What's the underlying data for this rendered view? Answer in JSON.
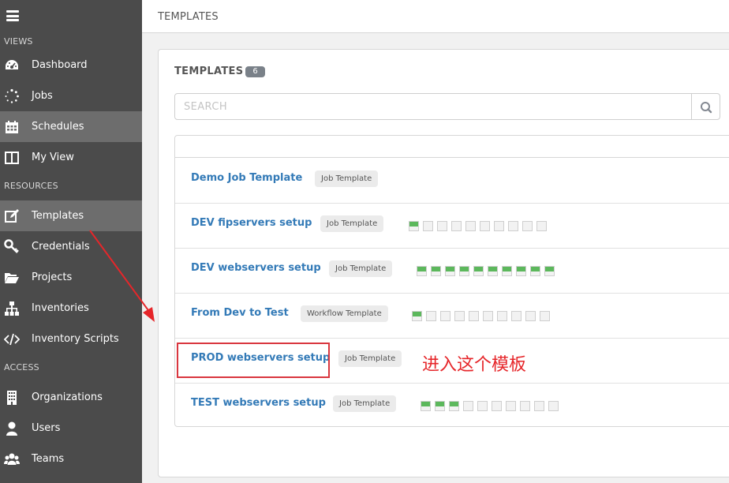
{
  "sidebar": {
    "sections": {
      "views": "VIEWS",
      "resources": "RESOURCES",
      "access": "ACCESS"
    },
    "items": [
      {
        "label": "Dashboard",
        "icon": "dashboard-icon",
        "active": false
      },
      {
        "label": "Jobs",
        "icon": "jobs-spinner-icon",
        "active": false
      },
      {
        "label": "Schedules",
        "icon": "calendar-icon",
        "active": true
      },
      {
        "label": "My View",
        "icon": "columns-icon",
        "active": false
      },
      {
        "label": "Templates",
        "icon": "edit-icon",
        "active": true
      },
      {
        "label": "Credentials",
        "icon": "key-icon",
        "active": false
      },
      {
        "label": "Projects",
        "icon": "folder-open-icon",
        "active": false
      },
      {
        "label": "Inventories",
        "icon": "sitemap-icon",
        "active": false
      },
      {
        "label": "Inventory Scripts",
        "icon": "code-icon",
        "active": false
      },
      {
        "label": "Organizations",
        "icon": "building-icon",
        "active": false
      },
      {
        "label": "Users",
        "icon": "user-icon",
        "active": false
      },
      {
        "label": "Teams",
        "icon": "users-icon",
        "active": false
      }
    ]
  },
  "breadcrumb": {
    "title": "TEMPLATES"
  },
  "panel": {
    "title": "TEMPLATES",
    "count": "6",
    "search": {
      "placeholder": "SEARCH",
      "value": ""
    }
  },
  "templates": [
    {
      "name": "Demo Job Template",
      "type": "Job Template",
      "jobs": []
    },
    {
      "name": "DEV fipservers setup",
      "type": "Job Template",
      "jobs": [
        "ok",
        "none",
        "none",
        "none",
        "none",
        "none",
        "none",
        "none",
        "none",
        "none"
      ]
    },
    {
      "name": "DEV webservers setup",
      "type": "Job Template",
      "jobs": [
        "ok",
        "ok",
        "ok",
        "ok",
        "ok",
        "ok",
        "ok",
        "ok",
        "ok",
        "ok"
      ]
    },
    {
      "name": "From Dev to Test",
      "type": "Workflow Template",
      "jobs": [
        "ok",
        "none",
        "none",
        "none",
        "none",
        "none",
        "none",
        "none",
        "none",
        "none"
      ]
    },
    {
      "name": "PROD webservers setup",
      "type": "Job Template",
      "jobs": []
    },
    {
      "name": "TEST webservers setup",
      "type": "Job Template",
      "jobs": [
        "ok",
        "ok",
        "ok",
        "none",
        "none",
        "none",
        "none",
        "none",
        "none",
        "none"
      ]
    }
  ],
  "annotation": {
    "text": "进入这个模板",
    "color": "#e6262a"
  },
  "colors": {
    "sidebar_bg": "#4b4b4b",
    "link": "#337ab7",
    "job_success": "#5cb85c"
  }
}
